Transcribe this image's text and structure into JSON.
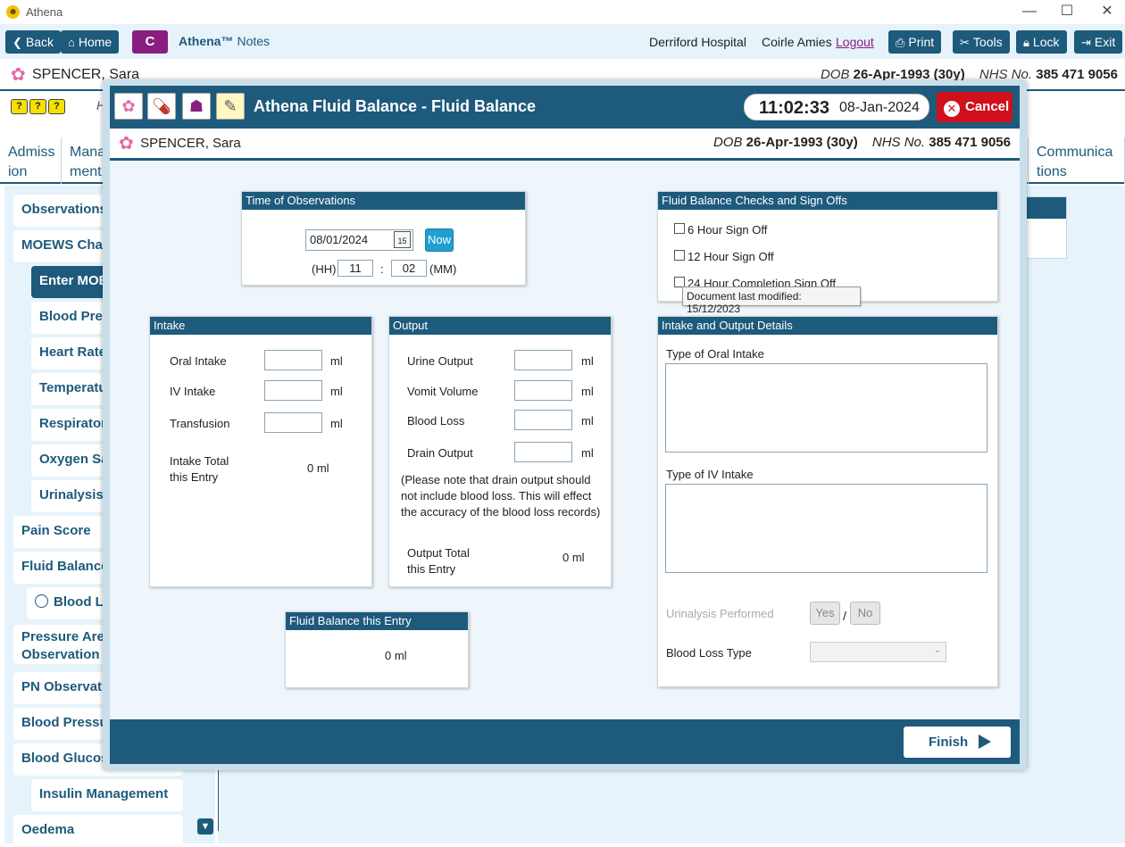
{
  "window": {
    "title": "Athena",
    "minimize": "—",
    "maximize": "☐",
    "close": "✕"
  },
  "toolbar": {
    "back": "Back",
    "home": "Home",
    "c": "C",
    "brand": "Athena™",
    "brand_sub": "Notes",
    "hospital": "Derriford Hospital",
    "user": "Coirle Amies",
    "logout": "Logout",
    "print": "Print",
    "tools": "Tools",
    "lock": "Lock",
    "exit": "Exit"
  },
  "patient": {
    "name": "SPENCER, Sara",
    "dob_label": "DOB",
    "dob": "26-Apr-1993 (30y)",
    "nhs_label": "NHS No.",
    "nhs": "385 471 9056"
  },
  "bg_tabs": [
    {
      "label": "Admiss ion"
    },
    {
      "label": "Mana ment"
    },
    {
      "label": "Communica tions"
    }
  ],
  "bg_h": "H",
  "sidebar": {
    "items": [
      {
        "label": "Observations"
      },
      {
        "label": "MOEWS Chart"
      },
      {
        "label": "Enter MOEWS"
      },
      {
        "label": "Blood Pressure"
      },
      {
        "label": "Heart Rate"
      },
      {
        "label": "Temperature"
      },
      {
        "label": "Respiratory"
      },
      {
        "label": "Oxygen Sat"
      },
      {
        "label": "Urinalysis"
      },
      {
        "label": "Pain Score"
      },
      {
        "label": "Fluid Balance"
      },
      {
        "label": "Blood Loss"
      },
      {
        "label": "Pressure Areas Observation"
      },
      {
        "label": "PN Observations"
      },
      {
        "label": "Blood Pressure"
      },
      {
        "label": "Blood Glucose"
      },
      {
        "label": "Insulin Management"
      },
      {
        "label": "Oedema"
      }
    ]
  },
  "modal": {
    "title": "Athena Fluid Balance - Fluid Balance",
    "time": "11:02:33",
    "date": "08-Jan-2024",
    "cancel": "Cancel",
    "finish": "Finish",
    "time_obs": {
      "header": "Time of Observations",
      "date_value": "08/01/2024",
      "cal_day": "15",
      "now": "Now",
      "hh_label": "(HH)",
      "hh": "11",
      "sep": ":",
      "mm": "02",
      "mm_label": "(MM)"
    },
    "checks": {
      "header": "Fluid Balance Checks and Sign Offs",
      "items": [
        "6 Hour Sign Off",
        "12 Hour Sign Off",
        "24 Hour Completion Sign Off"
      ]
    },
    "tooltip": "Document last modified: 15/12/2023",
    "intake": {
      "header": "Intake",
      "oral": "Oral Intake",
      "iv": "IV Intake",
      "transfusion": "Transfusion",
      "unit": "ml",
      "total_label_1": "Intake Total",
      "total_label_2": "this Entry",
      "total": "0 ml"
    },
    "output": {
      "header": "Output",
      "urine": "Urine Output",
      "vomit": "Vomit Volume",
      "blood": "Blood Loss",
      "drain": "Drain Output",
      "unit": "ml",
      "note_1": "(Please note that drain output should",
      "note_2": "not include blood loss. This will effect",
      "note_3": "the accuracy of the blood loss records)",
      "total_label_1": "Output Total",
      "total_label_2": "this Entry",
      "total": "0 ml"
    },
    "details": {
      "header": "Intake and Output Details",
      "oral_type": "Type of Oral Intake",
      "iv_type": "Type of IV Intake",
      "urinalysis": "Urinalysis Performed",
      "yes": "Yes",
      "slash": "/",
      "no": "No",
      "blood_loss_type": "Blood Loss Type"
    },
    "balance": {
      "header": "Fluid Balance this Entry",
      "value": "0 ml"
    }
  }
}
